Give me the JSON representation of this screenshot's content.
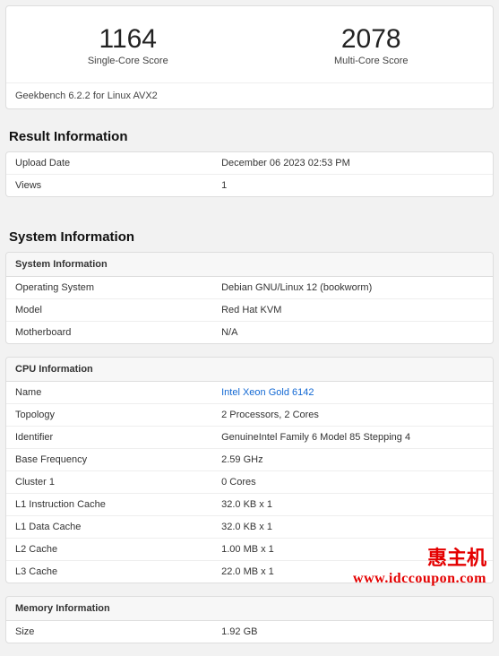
{
  "scores": {
    "single": {
      "value": "1164",
      "label": "Single-Core Score"
    },
    "multi": {
      "value": "2078",
      "label": "Multi-Core Score"
    },
    "footer": "Geekbench 6.2.2 for Linux AVX2"
  },
  "result_info": {
    "heading": "Result Information",
    "rows": [
      {
        "key": "Upload Date",
        "val": "December 06 2023 02:53 PM"
      },
      {
        "key": "Views",
        "val": "1"
      }
    ]
  },
  "system_info": {
    "heading": "System Information",
    "panel_title": "System Information",
    "rows": [
      {
        "key": "Operating System",
        "val": "Debian GNU/Linux 12 (bookworm)"
      },
      {
        "key": "Model",
        "val": "Red Hat KVM"
      },
      {
        "key": "Motherboard",
        "val": "N/A"
      }
    ]
  },
  "cpu_info": {
    "panel_title": "CPU Information",
    "rows": [
      {
        "key": "Name",
        "val": "Intel Xeon Gold 6142",
        "link": true
      },
      {
        "key": "Topology",
        "val": "2 Processors, 2 Cores"
      },
      {
        "key": "Identifier",
        "val": "GenuineIntel Family 6 Model 85 Stepping 4"
      },
      {
        "key": "Base Frequency",
        "val": "2.59 GHz"
      },
      {
        "key": "Cluster 1",
        "val": "0 Cores"
      },
      {
        "key": "L1 Instruction Cache",
        "val": "32.0 KB x 1"
      },
      {
        "key": "L1 Data Cache",
        "val": "32.0 KB x 1"
      },
      {
        "key": "L2 Cache",
        "val": "1.00 MB x 1"
      },
      {
        "key": "L3 Cache",
        "val": "22.0 MB x 1"
      }
    ]
  },
  "memory_info": {
    "panel_title": "Memory Information",
    "rows": [
      {
        "key": "Size",
        "val": "1.92 GB"
      }
    ]
  },
  "watermark": {
    "line1": "惠主机",
    "line2": "www.idccoupon.com"
  }
}
